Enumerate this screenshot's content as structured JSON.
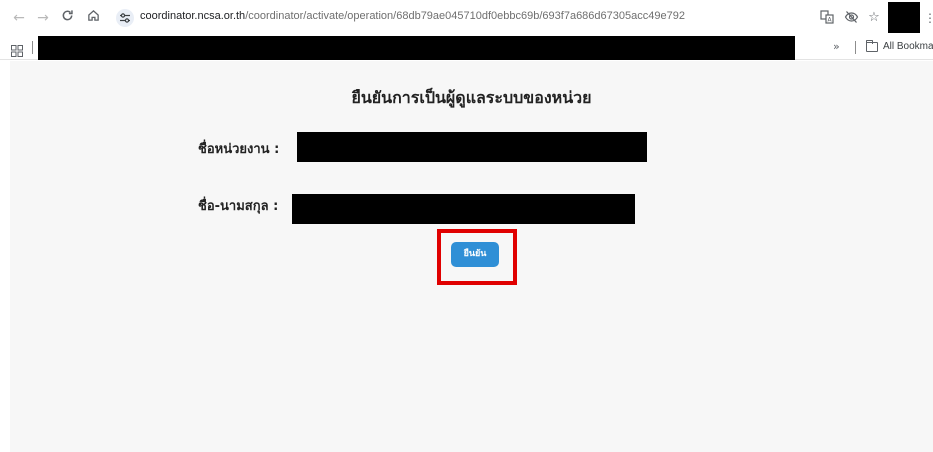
{
  "browser": {
    "url_host": "coordinator.ncsa.or.th",
    "url_path": "/coordinator/activate/operation/68db79ae045710df0ebbc69b/693f7a686d67305acc49e792",
    "bookmarks": {
      "overflow_label": "»",
      "all_bookmarks_label": "All Bookmarks"
    },
    "icons": {
      "back": "back-arrow-icon",
      "forward": "forward-arrow-icon",
      "reload": "reload-icon",
      "home": "home-icon",
      "site_info": "tune-icon",
      "translate": "translate-icon",
      "hide": "eye-slash-icon",
      "bookmark": "star-icon",
      "menu": "more-vert-icon",
      "apps": "apps-grid-icon",
      "folder": "folder-icon"
    }
  },
  "page": {
    "title": "ยืนยันการเป็นผู้ดูแลระบบของหน่วย",
    "org_label": "ชื่อหน่วยงาน :",
    "name_label": "ชื่อ-นามสกุล :",
    "confirm_button": "ยืนยัน"
  },
  "colors": {
    "page_background": "#f7f7f7",
    "button": "#2f8fd6",
    "highlight_box": "#e00000",
    "redaction": "#000000"
  }
}
